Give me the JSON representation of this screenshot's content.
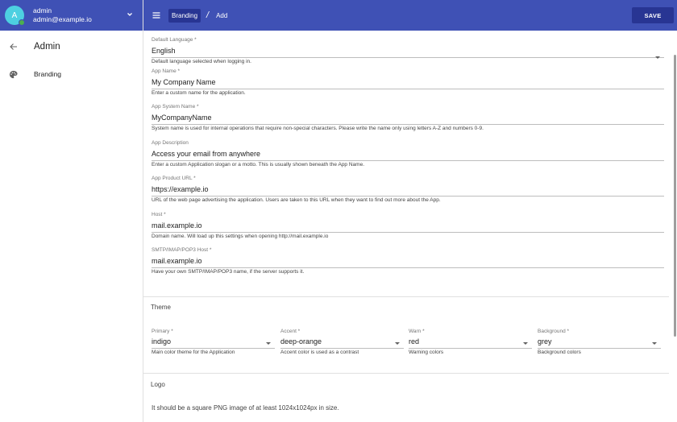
{
  "user": {
    "initial": "A",
    "name": "admin",
    "email": "admin@example.io"
  },
  "sidebar": {
    "title": "Admin",
    "items": [
      {
        "label": "Branding",
        "icon": "palette-icon"
      }
    ]
  },
  "topbar": {
    "breadcrumb_active": "Branding",
    "breadcrumb_sep": "/",
    "breadcrumb_current": "Add",
    "save_label": "SAVE"
  },
  "colors": {
    "primary": "#3f51b5",
    "primary_dark": "#283593",
    "avatar": "#4dd0e1",
    "online": "#4caf50"
  },
  "form": {
    "default_language": {
      "label": "Default Language *",
      "value": "English",
      "hint": "Default language selected when logging in."
    },
    "app_name": {
      "label": "App Name *",
      "value": "My Company Name",
      "hint": "Enter a custom name for the application."
    },
    "app_system_name": {
      "label": "App System Name *",
      "value": "MyCompanyName",
      "hint": "System name is used for internal operations that require non-special characters. Please write the name only using letters A-Z and numbers 0-9."
    },
    "app_description": {
      "label": "App Description",
      "value": "Access your email from anywhere",
      "hint": "Enter a custom Application slogan or a motto. This is usually shown beneath the App Name."
    },
    "app_product_url": {
      "label": "App Product URL *",
      "value": "https://example.io",
      "hint": "URL of the web page advertising the application. Users are taken to this URL when they want to find out more about the App."
    },
    "host": {
      "label": "Host *",
      "value": "mail.example.io",
      "hint": "Domain name. Will load up this settings when opening http://mail.example.io"
    },
    "smtp_host": {
      "label": "SMTP/IMAP/POP3 Host *",
      "value": "mail.example.io",
      "hint": "Have your own SMTP/IMAP/POP3 name, if the server supports it."
    }
  },
  "theme": {
    "title": "Theme",
    "primary": {
      "label": "Primary *",
      "value": "indigo",
      "hint": "Main color theme for the Application"
    },
    "accent": {
      "label": "Accent *",
      "value": "deep-orange",
      "hint": "Accent color is used as a contrast"
    },
    "warn": {
      "label": "Warn *",
      "value": "red",
      "hint": "Warning colors"
    },
    "background": {
      "label": "Background *",
      "value": "grey",
      "hint": "Background colors"
    }
  },
  "logo": {
    "title": "Logo",
    "hint": "It should be a square PNG image of at least 1024x1024px in size."
  }
}
